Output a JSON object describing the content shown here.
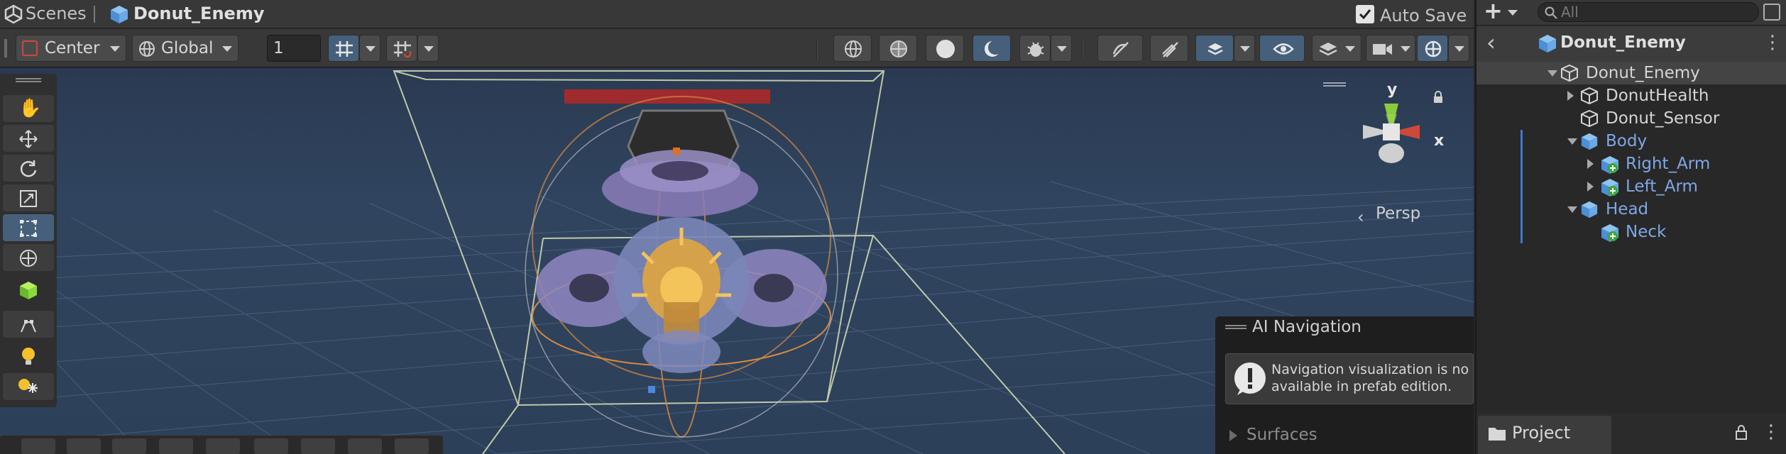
{
  "breadcrumb": {
    "scenes_label": "Scenes",
    "prefab_label": "Donut_Enemy",
    "auto_save_label": "Auto Save",
    "auto_save_checked": true
  },
  "toolbar": {
    "pivot_mode": "Center",
    "pivot_rotation": "Global",
    "grid_size_value": "1"
  },
  "scene_view": {
    "projection_label": "Persp",
    "gizmo_axes": [
      "y",
      "x"
    ]
  },
  "ai_navigation": {
    "title": "AI Navigation",
    "message_line1": "Navigation visualization is no",
    "message_line2": "available in prefab edition.",
    "surfaces_label": "Surfaces"
  },
  "hierarchy": {
    "search_placeholder": "All",
    "header_title": "Donut_Enemy",
    "items": [
      {
        "label": "Donut_Enemy"
      },
      {
        "label": "DonutHealth"
      },
      {
        "label": "Donut_Sensor"
      },
      {
        "label": "Body"
      },
      {
        "label": "Right_Arm"
      },
      {
        "label": "Left_Arm"
      },
      {
        "label": "Head"
      },
      {
        "label": "Neck"
      }
    ]
  },
  "project_tab": {
    "label": "Project"
  },
  "colors": {
    "accent_blue": "#7fa7e6",
    "active_button": "#46607c",
    "health_bar": "#b42828",
    "axis_y": "#8ccc3c",
    "axis_x": "#d04838"
  }
}
